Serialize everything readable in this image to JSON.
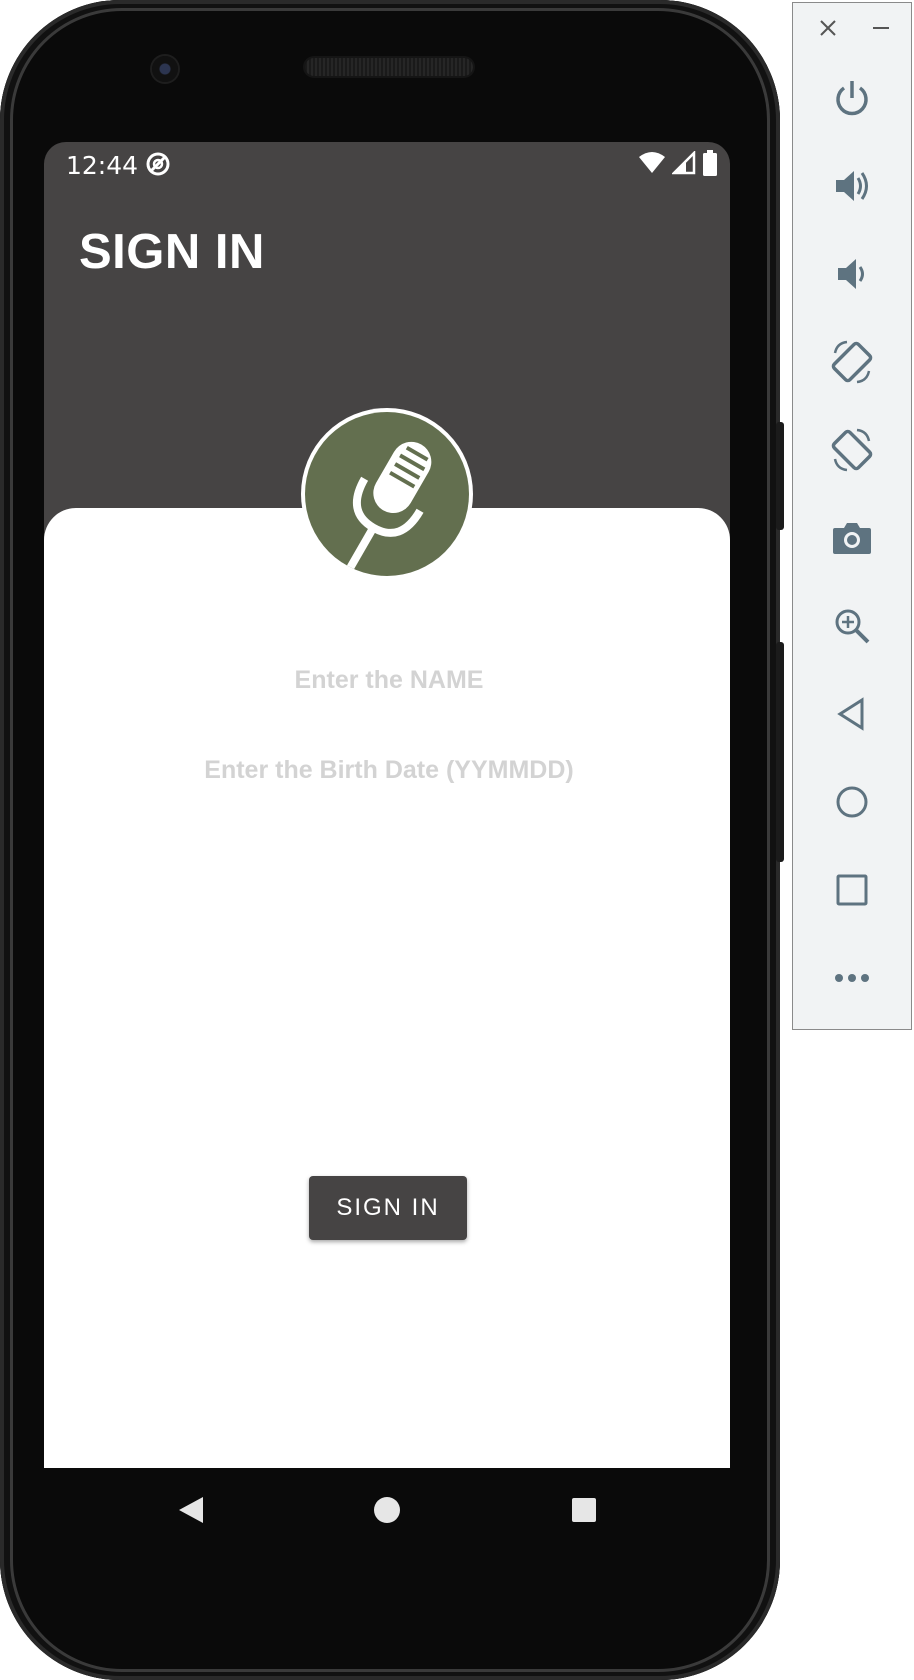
{
  "status_bar": {
    "time": "12:44"
  },
  "app": {
    "title": "SIGN IN",
    "name_placeholder": "Enter the NAME",
    "birth_placeholder": "Enter the Birth Date (YYMMDD)",
    "sign_in_button": "SIGN IN"
  },
  "colors": {
    "header_bg": "#464444",
    "logo_bg": "#636f4f",
    "placeholder": "#d3d3d3",
    "panel_icon": "#5e7380"
  },
  "emulator_panel": {
    "icons": [
      "close-icon",
      "minimize-icon",
      "power-icon",
      "volume-up-icon",
      "volume-down-icon",
      "rotate-left-icon",
      "rotate-right-icon",
      "camera-icon",
      "zoom-icon",
      "back-icon",
      "home-icon",
      "overview-icon",
      "more-icon"
    ]
  }
}
